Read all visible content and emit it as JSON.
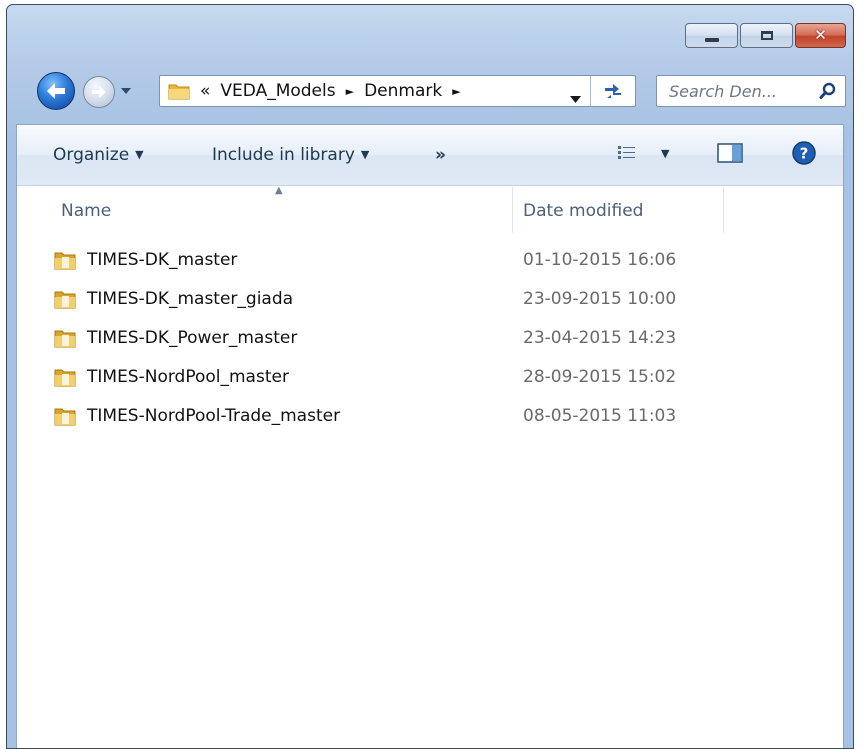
{
  "window": {
    "caption": {
      "minimize_icon": "minimize-icon",
      "maximize_icon": "maximize-icon",
      "close_glyph": "✕"
    }
  },
  "nav": {
    "address": {
      "overflow": "«",
      "crumbs": [
        "VEDA_Models",
        "Denmark"
      ],
      "separator": "►"
    },
    "search": {
      "placeholder": "Search Den..."
    }
  },
  "toolbar": {
    "organize": "Organize",
    "include_in_library": "Include in library",
    "more": "»"
  },
  "columns": {
    "name": "Name",
    "date_modified": "Date modified"
  },
  "files": [
    {
      "name": "TIMES-DK_master",
      "date": "01-10-2015 16:06"
    },
    {
      "name": "TIMES-DK_master_giada",
      "date": "23-09-2015 10:00"
    },
    {
      "name": "TIMES-DK_Power_master",
      "date": "23-04-2015 14:23"
    },
    {
      "name": "TIMES-NordPool_master",
      "date": "28-09-2015 15:02"
    },
    {
      "name": "TIMES-NordPool-Trade_master",
      "date": "08-05-2015 11:03"
    }
  ],
  "colors": {
    "window_frame": "#b3cbe8",
    "accent": "#2c7bd9",
    "folder": "#e9b83c"
  }
}
